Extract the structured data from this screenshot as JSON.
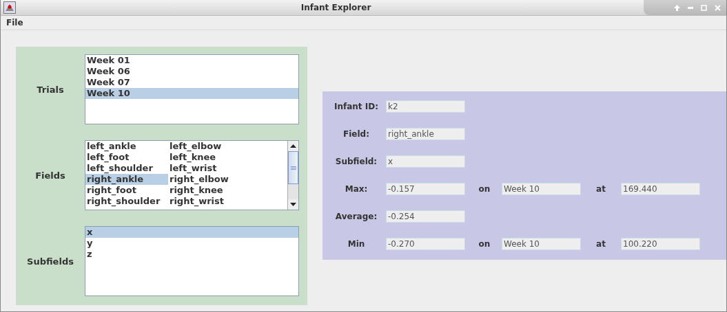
{
  "window": {
    "title": "Infant Explorer"
  },
  "menu": [
    "File"
  ],
  "lists": [
    {
      "label": "Trials",
      "kind": "single",
      "scroll": false,
      "items": [
        {
          "label": "Week 01",
          "selected": false
        },
        {
          "label": "Week 06",
          "selected": false
        },
        {
          "label": "Week 07",
          "selected": false
        },
        {
          "label": "Week 10",
          "selected": true
        }
      ]
    },
    {
      "label": "Fields",
      "kind": "grid",
      "scroll": true,
      "items": [
        {
          "label": "left_ankle",
          "selected": false
        },
        {
          "label": "left_elbow",
          "selected": false
        },
        {
          "label": "left_foot",
          "selected": false
        },
        {
          "label": "left_knee",
          "selected": false
        },
        {
          "label": "left_shoulder",
          "selected": false
        },
        {
          "label": "left_wrist",
          "selected": false
        },
        {
          "label": "right_ankle",
          "selected": true
        },
        {
          "label": "right_elbow",
          "selected": false
        },
        {
          "label": "right_foot",
          "selected": false
        },
        {
          "label": "right_knee",
          "selected": false
        },
        {
          "label": "right_shoulder",
          "selected": false
        },
        {
          "label": "right_wrist",
          "selected": false
        }
      ]
    },
    {
      "label": "Subfields",
      "kind": "single",
      "scroll": false,
      "items": [
        {
          "label": "x",
          "selected": true
        },
        {
          "label": "y",
          "selected": false
        },
        {
          "label": "z",
          "selected": false
        }
      ]
    }
  ],
  "details": [
    {
      "label": "Infant ID:",
      "value": "k2"
    },
    {
      "label": "Field:",
      "value": "right_ankle"
    },
    {
      "label": "Subfield:",
      "value": "x"
    },
    {
      "label": "Max:",
      "value": "-0.157",
      "on_label": "on",
      "on_value": "Week 10",
      "at_label": "at",
      "at_value": "169.440"
    },
    {
      "label": "Average:",
      "value": "-0.254"
    },
    {
      "label": "Min",
      "value": "-0.270",
      "on_label": "on",
      "on_value": "Week 10",
      "at_label": "at",
      "at_value": "100.220"
    }
  ]
}
